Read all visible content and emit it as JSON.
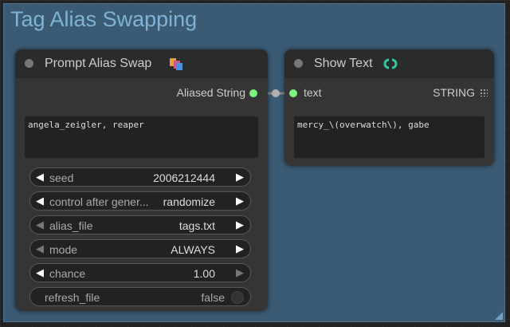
{
  "group": {
    "title": "Tag Alias Swapping"
  },
  "node_prompt": {
    "title": "Prompt Alias Swap",
    "output_label": "Aliased String",
    "text_value": "angela_zeigler, reaper",
    "widgets": {
      "seed": {
        "label": "seed",
        "value": "2006212444"
      },
      "control": {
        "label": "control after gener...",
        "value": "randomize"
      },
      "alias_file": {
        "label": "alias_file",
        "value": "tags.txt"
      },
      "mode": {
        "label": "mode",
        "value": "ALWAYS"
      },
      "chance": {
        "label": "chance",
        "value": "1.00"
      },
      "refresh_file": {
        "label": "refresh_file",
        "value": "false"
      }
    }
  },
  "node_show": {
    "title": "Show Text",
    "input_label": "text",
    "output_label": "STRING",
    "text_value": "mercy_\\(overwatch\\), gabe"
  },
  "colors": {
    "group_bg": "#3b5a73",
    "slot_green": "#7cf27c",
    "node_bg": "#353535"
  }
}
